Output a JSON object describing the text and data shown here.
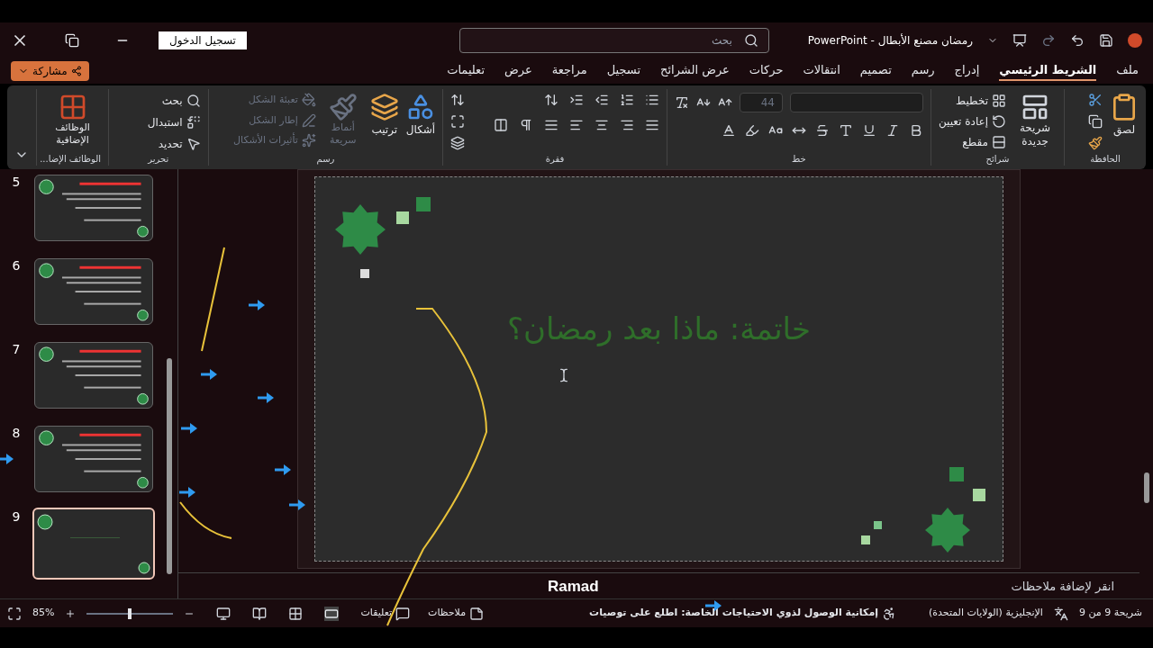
{
  "title_bar": {
    "title": "رمضان مصنع الأبطال - PowerPoint",
    "search_placeholder": "بحث",
    "sign_in": "تسجيل الدخول"
  },
  "tabs": [
    {
      "label": "ملف",
      "selected": false
    },
    {
      "label": "الشريط الرئيسي",
      "selected": true
    },
    {
      "label": "إدراج",
      "selected": false
    },
    {
      "label": "رسم",
      "selected": false
    },
    {
      "label": "تصميم",
      "selected": false
    },
    {
      "label": "انتقالات",
      "selected": false
    },
    {
      "label": "حركات",
      "selected": false
    },
    {
      "label": "عرض الشرائح",
      "selected": false
    },
    {
      "label": "تسجيل",
      "selected": false
    },
    {
      "label": "مراجعة",
      "selected": false
    },
    {
      "label": "عرض",
      "selected": false
    },
    {
      "label": "تعليمات",
      "selected": false
    }
  ],
  "share": "مشاركة",
  "ribbon": {
    "clipboard": {
      "label": "الحافظة",
      "paste": "لصق"
    },
    "slides": {
      "label": "شرائح",
      "new_slide": "شريحة جديدة",
      "layout": "تخطيط",
      "reset": "إعادة تعيين",
      "section": "مقطع"
    },
    "font": {
      "label": "خط",
      "font_size": "44"
    },
    "paragraph": {
      "label": "فقرة"
    },
    "drawing": {
      "label": "رسم",
      "shapes": "أشكال",
      "arrange": "ترتيب",
      "quick_styles": {
        "text": "أنماط سريعة",
        "disabled": true
      },
      "commands": [
        {
          "label": "تعبئة الشكل",
          "disabled": true
        },
        {
          "label": "إطار الشكل",
          "disabled": true
        },
        {
          "label": "تأثيرات الأشكال",
          "disabled": true
        }
      ]
    },
    "editing": {
      "label": "تحرير",
      "commands": [
        "بحث",
        "استبدال",
        "تحديد"
      ]
    },
    "addins": {
      "label": "الوظائف الإضا...",
      "button": "الوظائف الإضافية"
    }
  },
  "slides": [
    {
      "number": "5",
      "kind": "text",
      "selected": false
    },
    {
      "number": "6",
      "kind": "text",
      "selected": false
    },
    {
      "number": "7",
      "kind": "text",
      "selected": false
    },
    {
      "number": "8",
      "kind": "text",
      "selected": false
    },
    {
      "number": "9",
      "kind": "blank",
      "selected": true
    }
  ],
  "slide": {
    "title": "خاتمة: ماذا بعد رمضان؟"
  },
  "caption": "Ramad",
  "notes_placeholder": "انقر لإضافة ملاحظات",
  "status_bar": {
    "slide_counter": "شريحة 9 من 9",
    "language": "الإنجليزية (الولايات المتحدة)",
    "accessibility": "إمكانية الوصول لذوي الاحتياجات الخاصة: اطلع على توصيات",
    "notes": "ملاحظات",
    "comments": "تعليقات",
    "zoom": "85%",
    "zoom_slider": {
      "level": 0.5
    }
  }
}
